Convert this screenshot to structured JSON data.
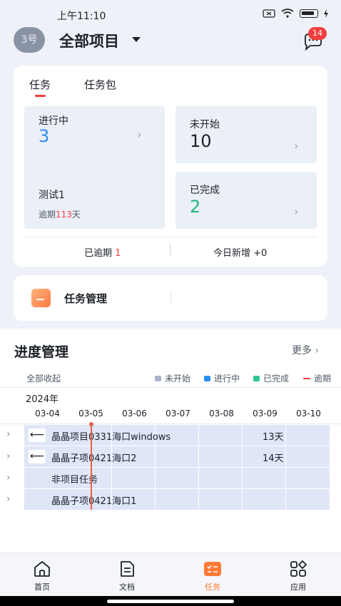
{
  "status_bar": {
    "time": "上午11:10"
  },
  "header": {
    "avatar": "3号",
    "title": "全部项目",
    "badge": "14"
  },
  "task_card": {
    "tabs": [
      {
        "label": "任务"
      },
      {
        "label": "任务包"
      }
    ],
    "in_progress": {
      "label": "进行中",
      "count": "3",
      "task_name": "测试1",
      "overdue_prefix": "逾期",
      "overdue_days": "113",
      "overdue_suffix": "天"
    },
    "not_started": {
      "label": "未开始",
      "count": "10"
    },
    "completed": {
      "label": "已完成",
      "count": "2"
    },
    "summary": {
      "overdue_label": "已逾期",
      "overdue_value": "1",
      "today_new": "今日新增 +0"
    }
  },
  "management": {
    "label": "任务管理"
  },
  "progress": {
    "title": "进度管理",
    "more": "更多",
    "collapse_all": "全部收起",
    "legend": [
      {
        "label": "未开始",
        "color": "#a9b4cc"
      },
      {
        "label": "进行中",
        "color": "#2b8ef5"
      },
      {
        "label": "已完成",
        "color": "#2fc58c"
      },
      {
        "label": "逾期",
        "color": "#f53f3f"
      }
    ],
    "year": "2024年",
    "dates": [
      "03-04",
      "03-05",
      "03-06",
      "03-07",
      "03-08",
      "03-09",
      "03-10"
    ],
    "rows": [
      {
        "name": "晶晶项目0331海口windows",
        "days": "13天"
      },
      {
        "name": "晶晶子项0421海口2",
        "days": "14天"
      },
      {
        "name": "非项目任务",
        "days": ""
      },
      {
        "name": "晶晶子项0421海口1",
        "days": ""
      }
    ]
  },
  "tabbar": [
    {
      "label": "首页",
      "icon": "home-icon"
    },
    {
      "label": "文档",
      "icon": "document-icon"
    },
    {
      "label": "任务",
      "icon": "task-icon"
    },
    {
      "label": "应用",
      "icon": "apps-icon"
    }
  ]
}
